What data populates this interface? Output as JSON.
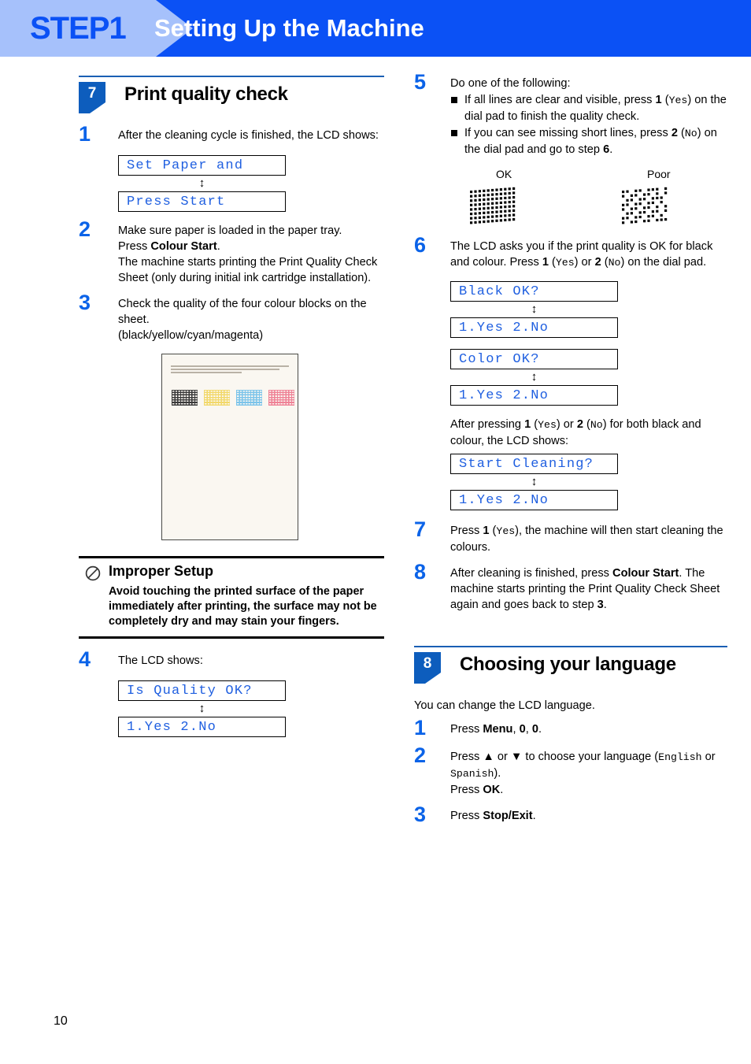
{
  "banner": {
    "step_label": "STEP1",
    "title": "Setting Up the Machine",
    "bg_color": "#0b51f5",
    "arrow_color": "#a6c1fb"
  },
  "page_number": "10",
  "left_column": {
    "section": {
      "number": "7",
      "title": "Print quality check"
    },
    "step1": {
      "number": "1",
      "text": "After the cleaning cycle is finished, the LCD shows:",
      "lcd_1": "Set Paper and",
      "lcd_arrow": "↕",
      "lcd_2": "Press Start"
    },
    "step2": {
      "number": "2",
      "line1": "Make sure paper is loaded in the paper tray.",
      "line2_pre": "Press ",
      "line2_bold": "Colour Start",
      "line2_post": ".",
      "line3": "The machine starts printing the Print Quality Check Sheet (only during initial ink cartridge installation)."
    },
    "step3": {
      "number": "3",
      "line1": "Check the quality of the four colour blocks on the sheet.",
      "line2": "(black/yellow/cyan/magenta)"
    },
    "check_sheet": {
      "blocks": [
        {
          "name": "black-block",
          "color": "#3a3a3a"
        },
        {
          "name": "yellow-block",
          "color": "#f2d86a"
        },
        {
          "name": "cyan-block",
          "color": "#7cc4ea"
        },
        {
          "name": "magenta-block",
          "color": "#ef8296"
        }
      ]
    },
    "warning": {
      "icon": "prohibited-icon",
      "title": "Improper Setup",
      "text": "Avoid touching the printed surface of the paper immediately after printing, the surface may not be completely dry and may stain your fingers."
    },
    "step4": {
      "number": "4",
      "text": "The LCD shows:",
      "lcd_1": "Is Quality OK?",
      "lcd_arrow": "↕",
      "lcd_2": "1.Yes 2.No"
    }
  },
  "right_column": {
    "step5": {
      "number": "5",
      "intro": "Do one of the following:",
      "bullet1": {
        "pre": "If all lines are clear and visible, press ",
        "bold1": "1",
        "mid": " (",
        "mono1": "Yes",
        "post": ") on the dial pad to finish the quality check."
      },
      "bullet2": {
        "pre": "If you can see missing short lines, press ",
        "bold1": "2",
        "mid": " (",
        "mono1": "No",
        "post": ") on the dial pad and go to step ",
        "bold2": "6",
        "end": "."
      },
      "label_ok": "OK",
      "label_poor": "Poor"
    },
    "step6": {
      "number": "6",
      "text_a": "The LCD asks you if the print quality is OK for black and colour. Press ",
      "bold1": "1",
      "paren1_open": " (",
      "mono1": "Yes",
      "paren1_close": ") or ",
      "bold2": "2",
      "paren2_open": " (",
      "mono2": "No",
      "paren2_close": ") on the dial pad.",
      "lcd_1": "Black OK?",
      "lcd_arrow_1": "↕",
      "lcd_2": "1.Yes 2.No",
      "lcd_3": "Color OK?",
      "lcd_arrow_2": "↕",
      "lcd_4": "1.Yes 2.No",
      "after_text_a": "After pressing ",
      "after_bold1": "1",
      "after_p1o": " (",
      "after_mono1": "Yes",
      "after_p1c": ") or ",
      "after_bold2": "2",
      "after_p2o": " (",
      "after_mono2": "No",
      "after_p2c": ") for both black and colour, the LCD shows:",
      "lcd_5": "Start Cleaning?",
      "lcd_arrow_3": "↕",
      "lcd_6": "1.Yes 2.No"
    },
    "step7": {
      "number": "7",
      "pre": "Press ",
      "bold1": "1",
      "p1o": " (",
      "mono1": "Yes",
      "p1c": "), the machine will then start cleaning the colours."
    },
    "step8": {
      "number": "8",
      "pre": "After cleaning is finished, press ",
      "bold1": "Colour Start",
      "mid": ". The machine starts printing the Print Quality Check Sheet again and goes back to step ",
      "bold2": "3",
      "end": "."
    },
    "section8": {
      "number": "8",
      "title": "Choosing your language"
    },
    "lang_intro": "You can change the LCD language.",
    "lang_step1": {
      "number": "1",
      "pre": "Press ",
      "bold1": "Menu",
      "mid1": ", ",
      "bold2": "0",
      "mid2": ", ",
      "bold3": "0",
      "end": "."
    },
    "lang_step2": {
      "number": "2",
      "pre": "Press ▲ or ▼ to choose your language (",
      "mono1": "English",
      "mid": " or ",
      "mono2": "Spanish",
      "post": ").",
      "line2_pre": "Press ",
      "line2_bold": "OK",
      "line2_end": "."
    },
    "lang_step3": {
      "number": "3",
      "pre": "Press ",
      "bold1": "Stop/Exit",
      "end": "."
    }
  }
}
